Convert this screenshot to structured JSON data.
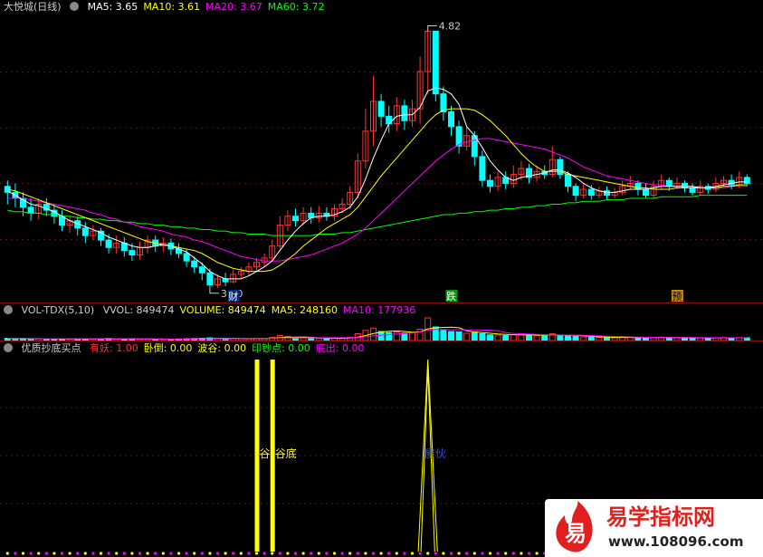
{
  "main_panel": {
    "title": "大悦城(日线)",
    "ma": [
      {
        "label": "MA5:",
        "value": "3.65",
        "color": "#ffffff"
      },
      {
        "label": "MA10:",
        "value": "3.61",
        "color": "#ffff00"
      },
      {
        "label": "MA20:",
        "value": "3.67",
        "color": "#ff00ff"
      },
      {
        "label": "MA60:",
        "value": "3.72",
        "color": "#00ff00"
      }
    ],
    "high_label": "4.82",
    "low_label": "3.10",
    "markers": [
      "财",
      "跌",
      "预"
    ]
  },
  "vol_panel": {
    "title": "VOL-TDX(5,10)",
    "items": [
      {
        "label": "VVOL:",
        "value": "849474",
        "color": "#cccccc"
      },
      {
        "label": "VOLUME:",
        "value": "849474",
        "color": "#ffff00"
      },
      {
        "label": "MA5:",
        "value": "248160",
        "color": "#ffff00"
      },
      {
        "label": "MA10:",
        "value": "177936",
        "color": "#ff00ff"
      }
    ]
  },
  "ind_panel": {
    "title": "优质抄底买点",
    "items": [
      {
        "label": "有妖:",
        "value": "1.00",
        "color": "#ff3030"
      },
      {
        "label": "卧倒:",
        "value": "0.00",
        "color": "#ffff00"
      },
      {
        "label": "波谷:",
        "value": "0.00",
        "color": "#ffff00"
      },
      {
        "label": "印钞点:",
        "value": "0.00",
        "color": "#00ff00"
      },
      {
        "label": "底出:",
        "value": "0.00",
        "color": "#ff00ff"
      }
    ],
    "bar_labels": [
      "谷",
      "谷底",
      "屋伙"
    ]
  },
  "watermark": {
    "logo_char": "易",
    "brand": "易学指标网",
    "url": "www.108096.com"
  },
  "colors": {
    "up": "#ff3333",
    "down": "#00ffff",
    "ma5": "#ffffff",
    "ma10": "#ffff00",
    "ma20": "#ff00ff",
    "ma60": "#00ff00"
  },
  "chart_data": {
    "type": "candlestick",
    "y_price_range": [
      3.05,
      4.92
    ],
    "candles": [
      [
        3.78,
        3.74,
        3.82,
        3.66
      ],
      [
        3.74,
        3.7,
        3.8,
        3.64
      ],
      [
        3.7,
        3.64,
        3.74,
        3.58
      ],
      [
        3.64,
        3.6,
        3.7,
        3.55
      ],
      [
        3.6,
        3.66,
        3.7,
        3.56
      ],
      [
        3.66,
        3.62,
        3.7,
        3.58
      ],
      [
        3.62,
        3.58,
        3.66,
        3.53
      ],
      [
        3.58,
        3.52,
        3.62,
        3.48
      ],
      [
        3.52,
        3.55,
        3.58,
        3.47
      ],
      [
        3.55,
        3.5,
        3.58,
        3.45
      ],
      [
        3.5,
        3.45,
        3.54,
        3.4
      ],
      [
        3.45,
        3.48,
        3.52,
        3.42
      ],
      [
        3.48,
        3.42,
        3.5,
        3.38
      ],
      [
        3.42,
        3.37,
        3.46,
        3.33
      ],
      [
        3.37,
        3.4,
        3.45,
        3.33
      ],
      [
        3.4,
        3.35,
        3.44,
        3.31
      ],
      [
        3.35,
        3.32,
        3.4,
        3.28
      ],
      [
        3.32,
        3.37,
        3.41,
        3.29
      ],
      [
        3.37,
        3.42,
        3.45,
        3.33
      ],
      [
        3.42,
        3.38,
        3.45,
        3.34
      ],
      [
        3.38,
        3.4,
        3.44,
        3.34
      ],
      [
        3.4,
        3.36,
        3.43,
        3.32
      ],
      [
        3.36,
        3.33,
        3.4,
        3.3
      ],
      [
        3.33,
        3.28,
        3.36,
        3.24
      ],
      [
        3.28,
        3.24,
        3.31,
        3.2
      ],
      [
        3.24,
        3.2,
        3.27,
        3.15
      ],
      [
        3.2,
        3.12,
        3.23,
        3.1
      ],
      [
        3.12,
        3.16,
        3.19,
        3.1
      ],
      [
        3.16,
        3.14,
        3.2,
        3.11
      ],
      [
        3.14,
        3.19,
        3.22,
        3.13
      ],
      [
        3.19,
        3.21,
        3.24,
        3.16
      ],
      [
        3.21,
        3.24,
        3.27,
        3.18
      ],
      [
        3.24,
        3.27,
        3.3,
        3.21
      ],
      [
        3.27,
        3.3,
        3.33,
        3.24
      ],
      [
        3.3,
        3.38,
        3.42,
        3.28
      ],
      [
        3.38,
        3.52,
        3.58,
        3.36
      ],
      [
        3.52,
        3.58,
        3.62,
        3.48
      ],
      [
        3.58,
        3.55,
        3.63,
        3.51
      ],
      [
        3.55,
        3.6,
        3.64,
        3.52
      ],
      [
        3.6,
        3.57,
        3.64,
        3.53
      ],
      [
        3.57,
        3.6,
        3.65,
        3.54
      ],
      [
        3.6,
        3.58,
        3.64,
        3.55
      ],
      [
        3.58,
        3.63,
        3.66,
        3.55
      ],
      [
        3.63,
        3.66,
        3.7,
        3.6
      ],
      [
        3.66,
        3.74,
        3.78,
        3.63
      ],
      [
        3.74,
        3.95,
        4.0,
        3.7
      ],
      [
        3.95,
        4.15,
        4.3,
        3.9
      ],
      [
        4.15,
        4.35,
        4.52,
        4.05
      ],
      [
        4.35,
        4.25,
        4.4,
        4.18
      ],
      [
        4.25,
        4.2,
        4.32,
        4.14
      ],
      [
        4.2,
        4.32,
        4.38,
        4.15
      ],
      [
        4.32,
        4.22,
        4.36,
        4.16
      ],
      [
        4.22,
        4.3,
        4.36,
        4.18
      ],
      [
        4.3,
        4.55,
        4.65,
        4.2
      ],
      [
        4.55,
        4.82,
        4.82,
        4.4
      ],
      [
        4.82,
        4.4,
        4.5,
        4.35
      ],
      [
        4.4,
        4.28,
        4.45,
        4.22
      ],
      [
        4.28,
        4.18,
        4.32,
        4.12
      ],
      [
        4.18,
        4.05,
        4.22,
        4.0
      ],
      [
        4.05,
        4.12,
        4.18,
        4.02
      ],
      [
        4.12,
        3.98,
        4.15,
        3.92
      ],
      [
        3.98,
        3.82,
        4.02,
        3.78
      ],
      [
        3.82,
        3.78,
        3.86,
        3.74
      ],
      [
        3.78,
        3.84,
        3.88,
        3.75
      ],
      [
        3.84,
        3.8,
        3.88,
        3.76
      ],
      [
        3.8,
        3.86,
        3.92,
        3.77
      ],
      [
        3.86,
        3.9,
        3.95,
        3.82
      ],
      [
        3.9,
        3.84,
        3.93,
        3.8
      ],
      [
        3.84,
        3.88,
        3.92,
        3.81
      ],
      [
        3.88,
        3.86,
        3.92,
        3.83
      ],
      [
        3.86,
        3.96,
        4.05,
        3.84
      ],
      [
        3.96,
        3.86,
        3.98,
        3.83
      ],
      [
        3.86,
        3.78,
        3.88,
        3.74
      ],
      [
        3.78,
        3.72,
        3.8,
        3.68
      ],
      [
        3.72,
        3.76,
        3.8,
        3.7
      ],
      [
        3.76,
        3.72,
        3.79,
        3.69
      ],
      [
        3.72,
        3.75,
        3.78,
        3.7
      ],
      [
        3.75,
        3.72,
        3.78,
        3.69
      ],
      [
        3.72,
        3.74,
        3.77,
        3.7
      ],
      [
        3.74,
        3.78,
        3.82,
        3.72
      ],
      [
        3.78,
        3.8,
        3.85,
        3.76
      ],
      [
        3.8,
        3.76,
        3.82,
        3.72
      ],
      [
        3.76,
        3.72,
        3.8,
        3.7
      ],
      [
        3.72,
        3.78,
        3.82,
        3.7
      ],
      [
        3.78,
        3.82,
        3.86,
        3.76
      ],
      [
        3.82,
        3.78,
        3.84,
        3.75
      ],
      [
        3.78,
        3.8,
        3.84,
        3.76
      ],
      [
        3.8,
        3.77,
        3.82,
        3.74
      ],
      [
        3.77,
        3.74,
        3.8,
        3.72
      ],
      [
        3.74,
        3.78,
        3.82,
        3.72
      ],
      [
        3.78,
        3.76,
        3.8,
        3.73
      ],
      [
        3.76,
        3.8,
        3.84,
        3.74
      ],
      [
        3.8,
        3.82,
        3.85,
        3.78
      ],
      [
        3.82,
        3.79,
        3.86,
        3.76
      ],
      [
        3.79,
        3.84,
        3.88,
        3.77
      ],
      [
        3.84,
        3.8,
        3.86,
        3.78
      ]
    ],
    "ma5": [
      3.75,
      3.72,
      3.69,
      3.66,
      3.65,
      3.63,
      3.61,
      3.58,
      3.55,
      3.53,
      3.51,
      3.49,
      3.47,
      3.44,
      3.42,
      3.4,
      3.38,
      3.37,
      3.37,
      3.38,
      3.39,
      3.38,
      3.36,
      3.34,
      3.3,
      3.26,
      3.21,
      3.18,
      3.16,
      3.16,
      3.16,
      3.18,
      3.21,
      3.24,
      3.28,
      3.35,
      3.42,
      3.48,
      3.53,
      3.57,
      3.58,
      3.58,
      3.59,
      3.61,
      3.64,
      3.71,
      3.83,
      3.97,
      4.09,
      4.2,
      4.25,
      4.26,
      4.26,
      4.31,
      4.42,
      4.44,
      4.43,
      4.4,
      4.33,
      4.18,
      4.12,
      4.04,
      3.95,
      3.89,
      3.84,
      3.82,
      3.84,
      3.85,
      3.86,
      3.87,
      3.89,
      3.89,
      3.87,
      3.84,
      3.8,
      3.77,
      3.75,
      3.74,
      3.74,
      3.75,
      3.76,
      3.76,
      3.76,
      3.77,
      3.78,
      3.78,
      3.78,
      3.78,
      3.78,
      3.77,
      3.77,
      3.78,
      3.79,
      3.8,
      3.81,
      3.81
    ],
    "ma10": [
      3.76,
      3.75,
      3.73,
      3.71,
      3.69,
      3.67,
      3.65,
      3.63,
      3.61,
      3.59,
      3.57,
      3.55,
      3.53,
      3.51,
      3.49,
      3.47,
      3.45,
      3.43,
      3.41,
      3.4,
      3.39,
      3.38,
      3.37,
      3.36,
      3.35,
      3.33,
      3.3,
      3.27,
      3.25,
      3.23,
      3.22,
      3.21,
      3.21,
      3.21,
      3.22,
      3.25,
      3.29,
      3.33,
      3.38,
      3.42,
      3.46,
      3.5,
      3.53,
      3.56,
      3.59,
      3.64,
      3.71,
      3.78,
      3.85,
      3.91,
      3.97,
      4.03,
      4.09,
      4.15,
      4.21,
      4.26,
      4.29,
      4.3,
      4.3,
      4.3,
      4.29,
      4.26,
      4.22,
      4.17,
      4.12,
      4.06,
      4.0,
      3.95,
      3.91,
      3.88,
      3.88,
      3.88,
      3.86,
      3.85,
      3.84,
      3.83,
      3.82,
      3.81,
      3.8,
      3.79,
      3.78,
      3.77,
      3.77,
      3.76,
      3.76,
      3.76,
      3.77,
      3.77,
      3.77,
      3.77,
      3.77,
      3.77,
      3.78,
      3.78,
      3.79,
      3.79
    ],
    "ma20": [
      3.7,
      3.7,
      3.7,
      3.69,
      3.68,
      3.67,
      3.66,
      3.65,
      3.64,
      3.63,
      3.62,
      3.6,
      3.59,
      3.57,
      3.56,
      3.54,
      3.53,
      3.51,
      3.5,
      3.49,
      3.48,
      3.46,
      3.45,
      3.44,
      3.42,
      3.41,
      3.39,
      3.37,
      3.35,
      3.33,
      3.31,
      3.3,
      3.29,
      3.28,
      3.28,
      3.28,
      3.29,
      3.3,
      3.31,
      3.32,
      3.34,
      3.36,
      3.38,
      3.4,
      3.43,
      3.46,
      3.5,
      3.55,
      3.6,
      3.65,
      3.7,
      3.75,
      3.8,
      3.85,
      3.9,
      3.95,
      3.99,
      4.03,
      4.06,
      4.08,
      4.09,
      4.1,
      4.1,
      4.09,
      4.08,
      4.07,
      4.06,
      4.05,
      4.04,
      4.03,
      4.01,
      3.99,
      3.97,
      3.94,
      3.91,
      3.89,
      3.87,
      3.85,
      3.84,
      3.83,
      3.82,
      3.81,
      3.8,
      3.79,
      3.79,
      3.78,
      3.78,
      3.78,
      3.78,
      3.77,
      3.77,
      3.77,
      3.77,
      3.78,
      3.78,
      3.78
    ],
    "ma60": [
      3.62,
      3.61,
      3.61,
      3.6,
      3.6,
      3.59,
      3.59,
      3.58,
      3.58,
      3.57,
      3.57,
      3.56,
      3.56,
      3.55,
      3.55,
      3.54,
      3.54,
      3.53,
      3.53,
      3.52,
      3.52,
      3.51,
      3.51,
      3.5,
      3.5,
      3.49,
      3.49,
      3.48,
      3.48,
      3.47,
      3.47,
      3.46,
      3.46,
      3.46,
      3.45,
      3.45,
      3.45,
      3.45,
      3.45,
      3.45,
      3.46,
      3.46,
      3.46,
      3.47,
      3.47,
      3.48,
      3.49,
      3.5,
      3.51,
      3.52,
      3.53,
      3.54,
      3.55,
      3.56,
      3.57,
      3.58,
      3.59,
      3.59,
      3.6,
      3.6,
      3.61,
      3.61,
      3.62,
      3.62,
      3.63,
      3.63,
      3.64,
      3.64,
      3.65,
      3.65,
      3.66,
      3.66,
      3.67,
      3.67,
      3.68,
      3.68,
      3.68,
      3.69,
      3.69,
      3.69,
      3.7,
      3.7,
      3.7,
      3.7,
      3.71,
      3.71,
      3.71,
      3.71,
      3.71,
      3.72,
      3.72,
      3.72,
      3.72,
      3.72,
      3.72,
      3.72
    ],
    "volume_rel": [
      0.1,
      0.08,
      0.09,
      0.07,
      0.08,
      0.06,
      0.07,
      0.08,
      0.06,
      0.07,
      0.08,
      0.06,
      0.07,
      0.09,
      0.06,
      0.07,
      0.08,
      0.06,
      0.07,
      0.06,
      0.05,
      0.06,
      0.07,
      0.08,
      0.09,
      0.1,
      0.12,
      0.09,
      0.08,
      0.09,
      0.08,
      0.09,
      0.1,
      0.09,
      0.14,
      0.22,
      0.18,
      0.12,
      0.11,
      0.1,
      0.1,
      0.09,
      0.1,
      0.11,
      0.14,
      0.3,
      0.45,
      0.55,
      0.4,
      0.35,
      0.38,
      0.33,
      0.36,
      0.5,
      1.0,
      0.6,
      0.45,
      0.4,
      0.38,
      0.32,
      0.35,
      0.3,
      0.25,
      0.24,
      0.22,
      0.26,
      0.28,
      0.24,
      0.22,
      0.2,
      0.3,
      0.24,
      0.2,
      0.18,
      0.16,
      0.15,
      0.14,
      0.13,
      0.12,
      0.14,
      0.15,
      0.13,
      0.12,
      0.14,
      0.15,
      0.13,
      0.12,
      0.12,
      0.11,
      0.12,
      0.11,
      0.12,
      0.13,
      0.12,
      0.13,
      0.12
    ],
    "signal_bars_index": [
      32,
      34
    ],
    "spike_index": [
      53,
      54,
      55
    ]
  }
}
